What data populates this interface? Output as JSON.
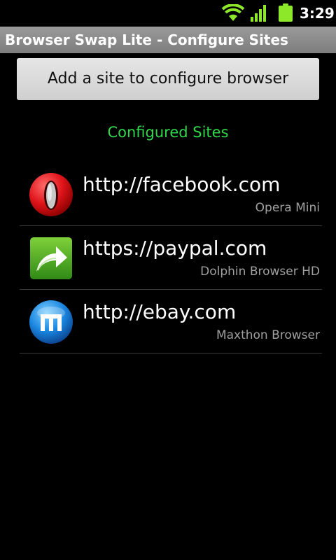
{
  "status_bar": {
    "time": "3:29",
    "icons": [
      "wifi-icon",
      "signal-icon",
      "battery-icon"
    ]
  },
  "app": {
    "title": "Browser Swap Lite - Configure Sites"
  },
  "add_button_label": "Add a site to configure browser",
  "section_heading": "Configured Sites",
  "colors": {
    "heading": "#2fd84a",
    "title_bar": "#8a8a8a",
    "button": "#d9d9d9"
  },
  "sites": [
    {
      "url": "http://facebook.com",
      "browser": "Opera Mini",
      "icon": "opera-mini-icon"
    },
    {
      "url": "https://paypal.com",
      "browser": "Dolphin Browser HD",
      "icon": "dolphin-browser-icon"
    },
    {
      "url": "http://ebay.com",
      "browser": "Maxthon Browser",
      "icon": "maxthon-browser-icon"
    }
  ]
}
